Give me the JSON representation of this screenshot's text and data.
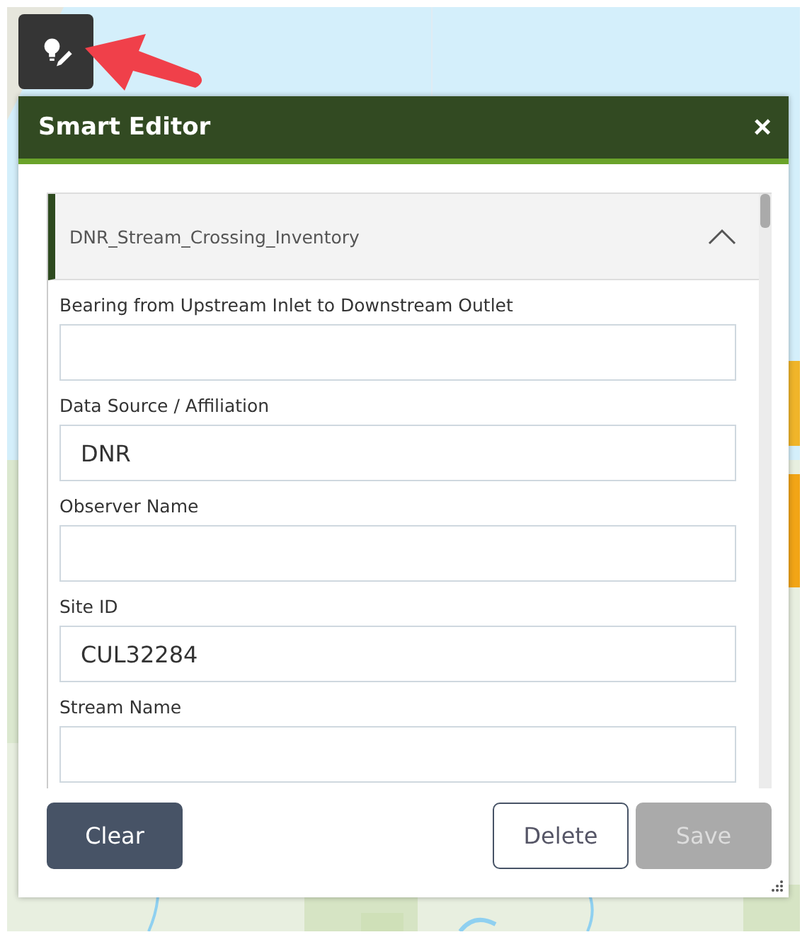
{
  "panel": {
    "title": "Smart Editor",
    "close": "×"
  },
  "layer": {
    "title": "DNR_Stream_Crossing_Inventory",
    "expanded": true
  },
  "fields": [
    {
      "label": "Bearing from Upstream Inlet to Downstream Outlet"
    },
    {
      "label": "Data Source / Affiliation",
      "value": "DNR"
    },
    {
      "label": "Observer Name"
    },
    {
      "label": "Site ID",
      "value": "CUL32284"
    },
    {
      "label": "Stream Name"
    }
  ],
  "buttons": [
    {
      "label": "Clear",
      "kind": "filled",
      "disabled": false
    },
    {
      "label": "Delete",
      "kind": "outline",
      "disabled": false
    },
    {
      "label": "Save",
      "kind": "filled",
      "disabled": true
    }
  ]
}
